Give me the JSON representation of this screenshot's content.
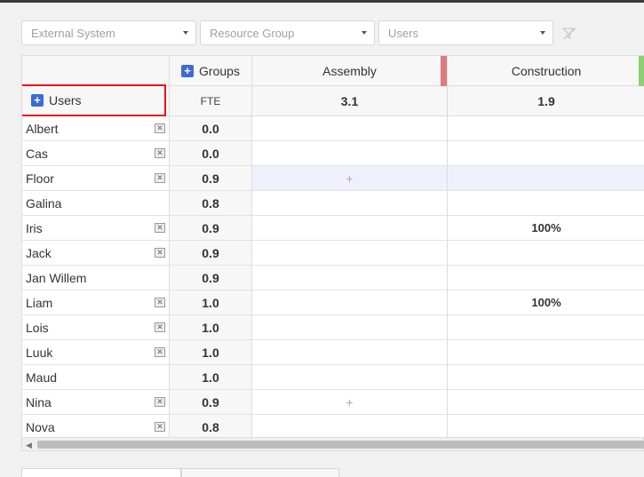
{
  "filters": {
    "external_system": "External System",
    "resource_group": "Resource Group",
    "users": "Users"
  },
  "header": {
    "groups_label": "Groups",
    "users_label": "Users",
    "fte_label": "FTE",
    "columns": [
      {
        "name": "Assembly",
        "total": "3.1",
        "color": "#e07b7b"
      },
      {
        "name": "Construction",
        "total": "1.9",
        "color": "#8ccf74"
      }
    ]
  },
  "rows": [
    {
      "name": "Albert",
      "fte": "0.0",
      "removable": true,
      "assembly": "",
      "construction": ""
    },
    {
      "name": "Cas",
      "fte": "0.0",
      "removable": true,
      "assembly": "",
      "construction": ""
    },
    {
      "name": "Floor",
      "fte": "0.9",
      "removable": true,
      "assembly": "+",
      "construction": "",
      "highlight": true
    },
    {
      "name": "Galina",
      "fte": "0.8",
      "removable": false,
      "assembly": "",
      "construction": ""
    },
    {
      "name": "Iris",
      "fte": "0.9",
      "removable": true,
      "assembly": "",
      "construction": "100%"
    },
    {
      "name": "Jack",
      "fte": "0.9",
      "removable": true,
      "assembly": "",
      "construction": ""
    },
    {
      "name": "Jan Willem",
      "fte": "0.9",
      "removable": false,
      "assembly": "",
      "construction": ""
    },
    {
      "name": "Liam",
      "fte": "1.0",
      "removable": true,
      "assembly": "",
      "construction": "100%"
    },
    {
      "name": "Lois",
      "fte": "1.0",
      "removable": true,
      "assembly": "",
      "construction": ""
    },
    {
      "name": "Luuk",
      "fte": "1.0",
      "removable": true,
      "assembly": "",
      "construction": ""
    },
    {
      "name": "Maud",
      "fte": "1.0",
      "removable": false,
      "assembly": "",
      "construction": ""
    },
    {
      "name": "Nina",
      "fte": "0.9",
      "removable": true,
      "assembly": "+",
      "construction": ""
    },
    {
      "name": "Nova",
      "fte": "0.8",
      "removable": true,
      "assembly": "",
      "construction": ""
    }
  ],
  "icons": {
    "remove": "✕",
    "add": "+",
    "scroll_left": "◀"
  }
}
